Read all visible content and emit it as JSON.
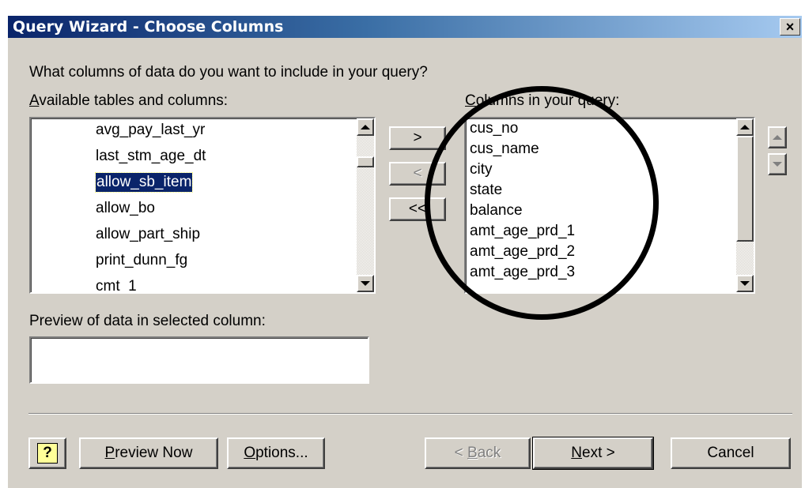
{
  "window": {
    "title": "Query Wizard - Choose Columns",
    "close_glyph": "×"
  },
  "prompt": "What columns of data do you want to include in your query?",
  "available": {
    "label": "Available tables and columns:",
    "items": [
      "avg_pay_last_yr",
      "last_stm_age_dt",
      "allow_sb_item",
      "allow_bo",
      "allow_part_ship",
      "print_dunn_fg",
      "cmt_1"
    ],
    "selected": "allow_sb_item"
  },
  "query": {
    "label": "Columns in your query:",
    "items": [
      "cus_no",
      "cus_name",
      "city",
      "state",
      "balance",
      "amt_age_prd_1",
      "amt_age_prd_2",
      "amt_age_prd_3"
    ]
  },
  "transfer": {
    "add": ">",
    "remove": "<",
    "remove_all": "<<"
  },
  "preview": {
    "label": "Preview of data in selected column:",
    "value": ""
  },
  "footer": {
    "help_icon": "?",
    "preview_now": "Preview Now",
    "options": "Options...",
    "back": "< Back",
    "next": "Next >",
    "cancel": "Cancel"
  },
  "icons": {
    "close": "close-icon",
    "help": "help-icon",
    "scroll_up": "triangle-up-icon",
    "scroll_down": "triangle-down-icon",
    "move_up": "triangle-up-icon",
    "move_down": "triangle-down-icon"
  }
}
